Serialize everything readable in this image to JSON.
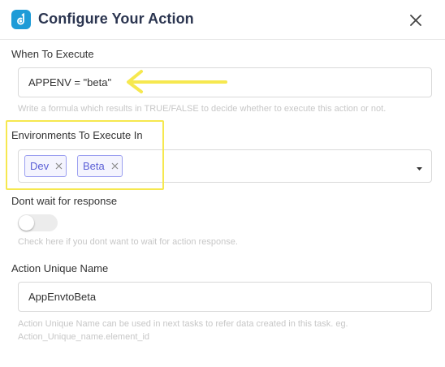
{
  "dialog": {
    "title": "Configure Your Action",
    "app_icon": "app-logo-icon",
    "close_icon": "close-icon"
  },
  "when_to_execute": {
    "label": "When To Execute",
    "value": "APPENV = \"beta\"",
    "help": "Write a formula which results in TRUE/FALSE to decide whether to execute this action or not."
  },
  "environments": {
    "label": "Environments To Execute In",
    "tags": [
      {
        "label": "Dev"
      },
      {
        "label": "Beta"
      }
    ],
    "dropdown_icon": "caret-down-icon"
  },
  "dont_wait": {
    "label": "Dont wait for response",
    "enabled": false,
    "help": "Check here if you dont want to wait for action response."
  },
  "unique_name": {
    "label": "Action Unique Name",
    "value": "AppEnvtoBeta",
    "help_line1": "Action Unique Name can be used in next tasks to refer data created in this task. eg.",
    "help_line2": "Action_Unique_name.element_id"
  },
  "annotations": {
    "highlight_color": "#f6e84f",
    "arrow_icon": "left-arrow-icon"
  },
  "colors": {
    "title": "#2b3550",
    "brand": "#1e9bd7",
    "tag_border": "#9b9ff0",
    "tag_text": "#5b5fd6"
  }
}
